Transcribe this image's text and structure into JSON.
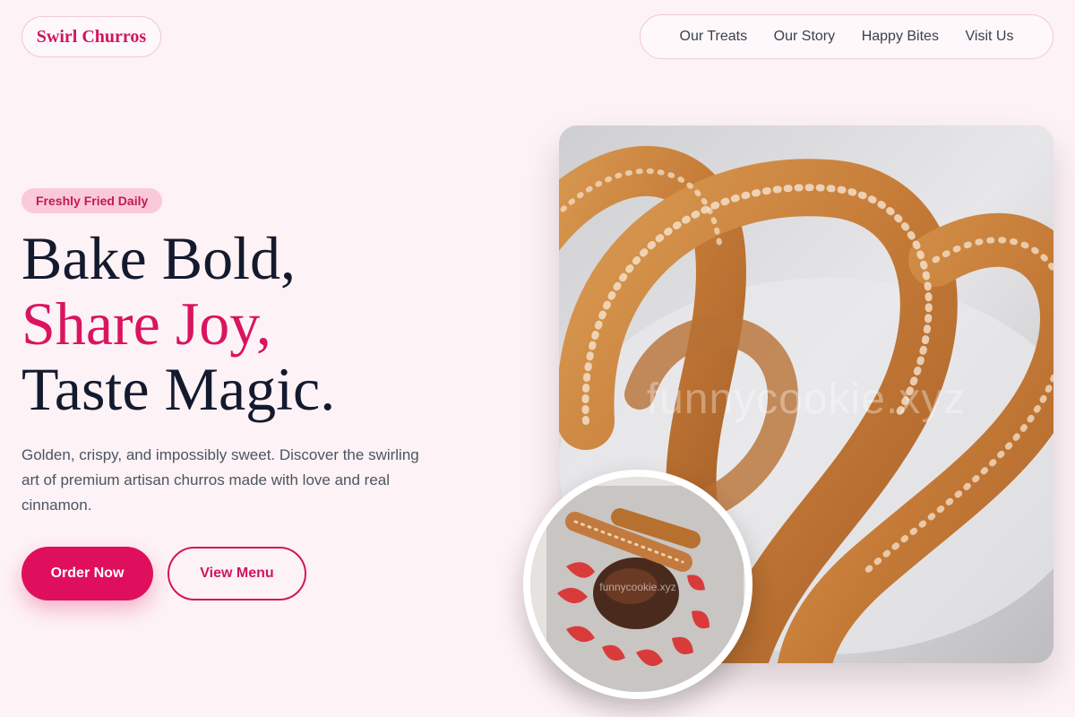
{
  "brand": {
    "name": "Swirl Churros"
  },
  "nav": {
    "items": [
      {
        "label": "Our Treats"
      },
      {
        "label": "Our Story"
      },
      {
        "label": "Happy Bites"
      },
      {
        "label": "Visit Us"
      }
    ]
  },
  "hero": {
    "badge": "Freshly Fried Daily",
    "headline": {
      "line1": "Bake Bold,",
      "line2": "Share Joy,",
      "line3": "Taste Magic."
    },
    "description": "Golden, crispy, and impossibly sweet. Discover the swirling art of premium artisan churros made with love and real cinnamon.",
    "primary_cta": "Order Now",
    "secondary_cta": "View Menu",
    "main_image": {
      "watermark": "funnycookie.xyz"
    },
    "secondary_image": {
      "watermark": "funnycookie.xyz"
    }
  },
  "colors": {
    "background": "#fdf2f5",
    "accent": "#df0f5e",
    "badge_bg": "#fbcad8",
    "heading": "#141a2e"
  },
  "icons": []
}
